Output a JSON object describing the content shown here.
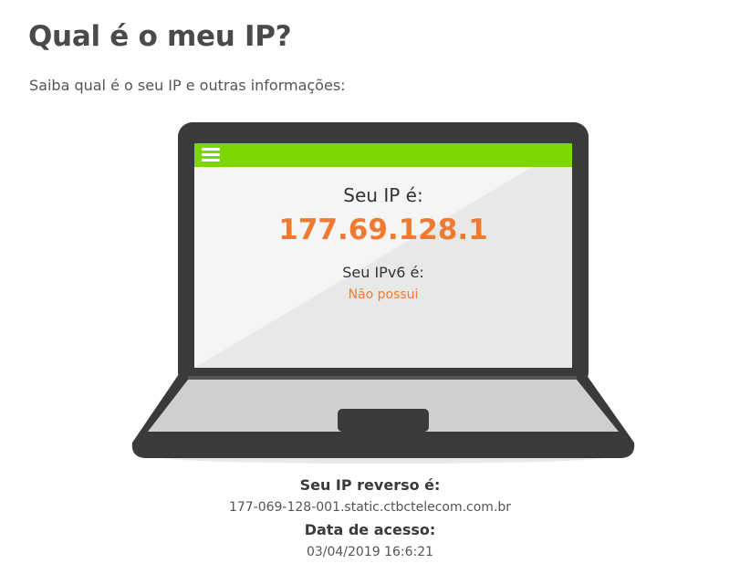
{
  "header": {
    "title": "Qual é o meu IP?",
    "subtitle": "Saiba qual é o seu IP e outras informações:"
  },
  "screen": {
    "ip_label": "Seu IP é:",
    "ip_value": "177.69.128.1",
    "ipv6_label": "Seu IPv6 é:",
    "ipv6_value": "Não possui",
    "menu_icon": "hamburger-menu-icon"
  },
  "details": {
    "reverse_label": "Seu IP reverso é:",
    "reverse_value": "177-069-128-001.static.ctbctelecom.com.br",
    "access_label": "Data de acesso:",
    "access_value": "03/04/2019 16:6:21"
  },
  "colors": {
    "accent_green": "#7ed600",
    "ip_orange": "#f07a32",
    "laptop_dark": "#3a3a3a"
  }
}
